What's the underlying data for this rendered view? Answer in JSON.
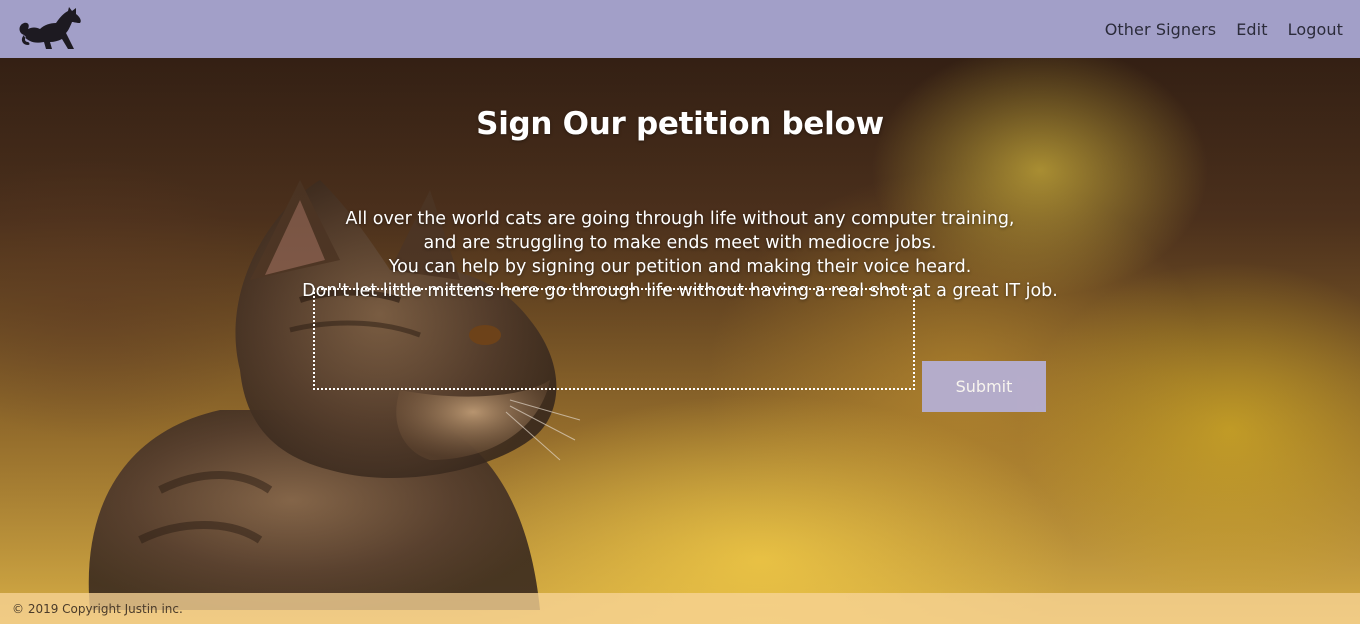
{
  "header": {
    "logo_icon": "cat-silhouette-icon",
    "nav": [
      {
        "label": "Other Signers"
      },
      {
        "label": "Edit"
      },
      {
        "label": "Logout"
      }
    ],
    "background": "#a29fc8"
  },
  "main": {
    "title": "Sign Our petition below",
    "description_lines": [
      "All over the world cats are going through life without any computer training,",
      "and are struggling to make ends meet with mediocre jobs.",
      "You can help by signing our petition and making their voice heard.",
      "Don't let little mittens here go through life without having a real shot at a great IT job."
    ],
    "signature_value": "",
    "submit_label": "Submit",
    "submit_color": "#b6b1d8"
  },
  "footer": {
    "copyright": "© 2019 Copyright Justin inc."
  }
}
